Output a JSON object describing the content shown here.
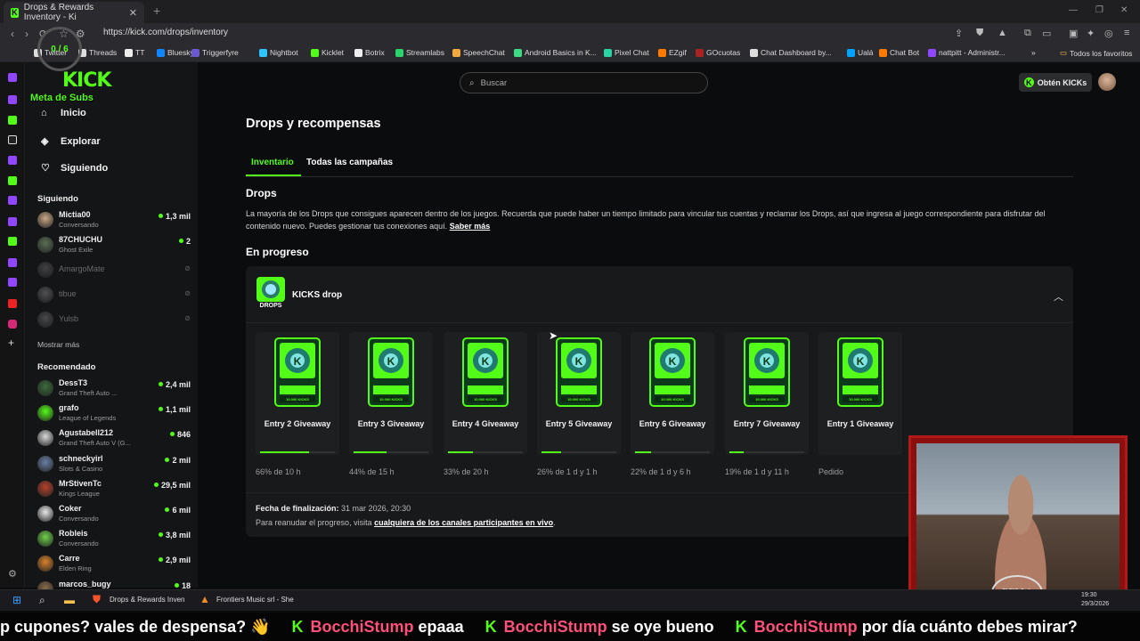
{
  "browser": {
    "tab_title": "Drops & Rewards Inventory - Ki",
    "url": "https://kick.com/drops/inventory",
    "bookmarks": [
      "Twitter",
      "Threads",
      "TT",
      "Bluesky",
      "Triggerfyre",
      "Nightbot",
      "Kicklet",
      "Botrix",
      "Streamlabs",
      "SpeechChat",
      "Android Basics in K...",
      "Pixel Chat",
      "EZgif",
      "GOcuotas",
      "Chat Dashboard by...",
      "Ualá",
      "Chat Bot",
      "nattpitt - Administr..."
    ],
    "bookmarks_all": "Todos los favoritos"
  },
  "header": {
    "search_placeholder": "Buscar",
    "kicks_button": "Obtén KICKs"
  },
  "sidebar": {
    "nav": [
      {
        "label": "Inicio",
        "icon": "home-icon"
      },
      {
        "label": "Explorar",
        "icon": "compass-icon"
      },
      {
        "label": "Siguiendo",
        "icon": "heart-icon"
      }
    ],
    "following_title": "Siguiendo",
    "following": [
      {
        "name": "Mictia00",
        "game": "Conversando",
        "viewers": "1,3 mil",
        "color": "#c9a887"
      },
      {
        "name": "87CHUCHU",
        "game": "Ghost Exile",
        "viewers": "2",
        "color": "#5a6e55"
      },
      {
        "name": "AmargoMate",
        "offline": true,
        "color": "#777"
      },
      {
        "name": "tibue",
        "offline": true,
        "color": "#999"
      },
      {
        "name": "Yulsb",
        "offline": true,
        "color": "#888"
      }
    ],
    "show_more": "Mostrar más",
    "recommended_title": "Recomendado",
    "recommended": [
      {
        "name": "DessT3",
        "game": "Grand Theft Auto ...",
        "viewers": "2,4 mil",
        "color": "#3b6b3b"
      },
      {
        "name": "grafo",
        "game": "League of Legends",
        "viewers": "1,1 mil",
        "color": "#53fc18"
      },
      {
        "name": "Agustabell212",
        "game": "Grand Theft Auto V (G...",
        "viewers": "846",
        "color": "#d8d8d8"
      },
      {
        "name": "schneckyirl",
        "game": "Slots & Casino",
        "viewers": "2 mil",
        "color": "#6a7fa5"
      },
      {
        "name": "MrStivenTc",
        "game": "Kings League",
        "viewers": "29,5 mil",
        "color": "#b5412b"
      },
      {
        "name": "Coker",
        "game": "Conversando",
        "viewers": "6 mil",
        "color": "#e8e8e8"
      },
      {
        "name": "Robleis",
        "game": "Conversando",
        "viewers": "3,8 mil",
        "color": "#6fd04a"
      },
      {
        "name": "Carre",
        "game": "Elden Ring",
        "viewers": "2,9 mil",
        "color": "#d9822b"
      },
      {
        "name": "marcos_bugy",
        "game": "",
        "viewers": "18",
        "color": "#8a6a4a"
      }
    ]
  },
  "main": {
    "title": "Drops y recompensas",
    "tabs": [
      "Inventario",
      "Todas las campañas"
    ],
    "drops_heading": "Drops",
    "drops_description": "La mayoría de los Drops que consigues aparecen dentro de los juegos. Recuerda que puede haber un tiempo limitado para vincular tus cuentas y reclamar los Drops, así que ingresa al juego correspondiente para disfrutar del contenido nuevo. Puedes gestionar tus conexiones aquí.",
    "learn_more": "Saber más",
    "in_progress_heading": "En progreso",
    "campaign": {
      "logo_label": "DROPS",
      "name": "KICKS drop",
      "card_badge": "10.000 KICKS",
      "rewards": [
        {
          "title": "Entry 2 Giveaway",
          "status": "66% de 10 h",
          "progress": 0.66
        },
        {
          "title": "Entry 3 Giveaway",
          "status": "44% de 15 h",
          "progress": 0.44
        },
        {
          "title": "Entry 4 Giveaway",
          "status": "33% de 20 h",
          "progress": 0.33
        },
        {
          "title": "Entry 5 Giveaway",
          "status": "26% de 1 d y 1 h",
          "progress": 0.26
        },
        {
          "title": "Entry 6 Giveaway",
          "status": "22% de 1 d y 6 h",
          "progress": 0.22
        },
        {
          "title": "Entry 7 Giveaway",
          "status": "19% de 1 d y 11 h",
          "progress": 0.19
        },
        {
          "title": "Entry 1 Giveaway",
          "status": "Pedido",
          "progress": 1.0
        }
      ],
      "end_label": "Fecha de finalización:",
      "end_value": "31 mar 2026, 20:30",
      "resume_text": "Para reanudar el progreso, visita",
      "resume_link": "cualquiera de los canales participantes en vivo",
      "resume_end": "."
    }
  },
  "overlay": {
    "sub_goal": "Meta de Subs",
    "sub_count": "0 / 6",
    "webcam_logo": "BELLA"
  },
  "taskbar": {
    "items": [
      "Drops & Rewards Inven",
      "Frontiers Music srl - She"
    ],
    "time": "19:30",
    "date": "29/3/2026"
  },
  "ticker": {
    "lead": "p cupones? vales de despensa? 👋",
    "messages": [
      {
        "user": "BocchiStump",
        "text": "epaaa"
      },
      {
        "user": "BocchiStump",
        "text": "se oye bueno"
      },
      {
        "user": "BocchiStump",
        "text": "por día cuánto debes mirar?"
      }
    ]
  },
  "colors": {
    "accent": "#53fc18",
    "panel": "#18191b",
    "background": "#0b0c0d"
  }
}
